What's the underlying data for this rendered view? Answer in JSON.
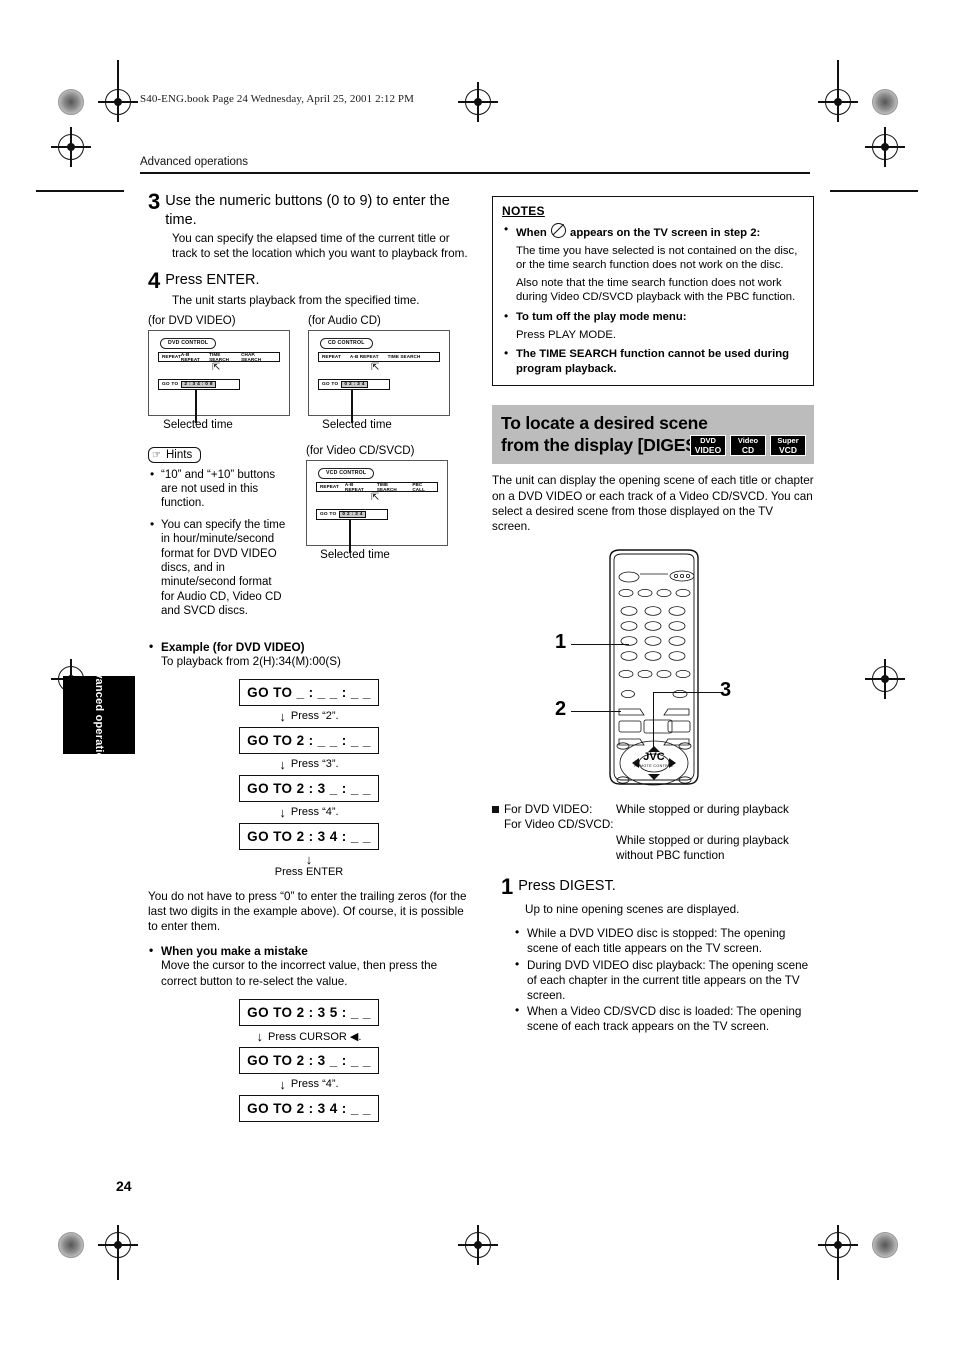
{
  "page": {
    "file_header": "S40-ENG.book  Page 24  Wednesday, April 25, 2001  2:12 PM",
    "running_head": "Advanced operations",
    "side_tab": "Advanced operations",
    "page_number": "24"
  },
  "left": {
    "step3": {
      "num": "3",
      "title": "Use the numeric buttons (0 to 9) to enter the time.",
      "body": "You can specify the elapsed time of the current title or track to set the location which you want to playback from."
    },
    "step4": {
      "num": "4",
      "title": "Press ENTER.",
      "body": "The unit starts playback from the specified time."
    },
    "figures": {
      "dvd": {
        "caption": "(for DVD VIDEO)",
        "pill": "DVD CONTROL",
        "menu": [
          "REPEAT",
          "A-B REPEAT",
          "TIME SEARCH",
          "CHAP. SEARCH"
        ],
        "goto_label": "GO TO",
        "goto_value": "2 : 3 4 : 0 8",
        "selected_caption": "Selected time"
      },
      "cd": {
        "caption": "(for Audio CD)",
        "pill": "CD CONTROL",
        "menu": [
          "REPEAT",
          "A-B REPEAT",
          "TIME SEARCH"
        ],
        "goto_label": "GO TO",
        "goto_value": "0 2 : 3 4",
        "selected_caption": "Selected time"
      },
      "vcd": {
        "caption": "(for Video CD/SVCD)",
        "pill": "VCD CONTROL",
        "menu": [
          "REPEAT",
          "A-B REPEAT",
          "TIME SEARCH",
          "PBC CALL"
        ],
        "goto_label": "GO TO",
        "goto_value": "0 2 : 3 4",
        "selected_caption": "Selected time"
      }
    },
    "hints": {
      "label": "Hints",
      "items": [
        "“10” and “+10” buttons are not used in this function.",
        "You can specify the time in hour/minute/second format for DVD VIDEO discs, and in minute/second format for Audio CD, Video CD and SVCD discs."
      ]
    },
    "example": {
      "heading": "Example (for DVD VIDEO)",
      "subtitle": "To playback from 2(H):34(M):00(S)",
      "steps": [
        {
          "display": "GO TO  _ : _ _ : _ _",
          "action": "Press “2”."
        },
        {
          "display": "GO TO  2 : _ _ : _ _",
          "action": "Press “3”."
        },
        {
          "display": "GO TO  2 : 3 _ : _ _",
          "action": "Press “4”."
        },
        {
          "display": "GO TO  2 : 3 4 : _ _",
          "action": "Press ENTER"
        }
      ]
    },
    "trailing_note": "You do not have to press “0” to enter the trailing zeros (for the last two digits in the example above). Of course, it is possible to enter them.",
    "mistake": {
      "heading": "When you make a mistake",
      "body": "Move the cursor to the incorrect value, then press the correct button to re-select the value.",
      "steps": [
        {
          "display": "GO TO  2 : 3 5 : _ _",
          "action": "Press CURSOR ◀."
        },
        {
          "display": "GO TO  2 : 3 _ : _ _",
          "action": "Press “4”."
        },
        {
          "display": "GO TO  2 : 3 4 : _ _",
          "action": ""
        }
      ]
    }
  },
  "right": {
    "notes": {
      "header": "NOTES",
      "items": [
        {
          "bold_before": "When",
          "has_prohibit_icon": true,
          "bold_after": "appears on the TV screen in step 2:",
          "paragraphs": [
            "The time you have selected is not contained on the disc, or the time search function does not work on the disc.",
            "Also note that the time search function does not work during Video CD/SVCD playback with the PBC function."
          ]
        },
        {
          "bold": "To tum off the play mode menu:",
          "paragraphs": [
            "Press PLAY MODE."
          ]
        },
        {
          "bold": "The TIME SEARCH function cannot be used during program playback.",
          "paragraphs": []
        }
      ]
    },
    "digest": {
      "title": "To locate a desired scene from the display [DIGEST]",
      "badges": [
        {
          "line1": "DVD",
          "line2": "VIDEO"
        },
        {
          "line1": "Video",
          "line2": "CD"
        },
        {
          "line1": "Super",
          "line2": "VCD"
        }
      ],
      "intro": "The unit can display the opening scene of each title or chapter on a DVD VIDEO or each track of a Video CD/SVCD.  You can select a desired scene from those displayed on the TV screen.",
      "remote": {
        "brand": "JVC",
        "brand_sub": "REMOTE CONTROL",
        "callouts": [
          "1",
          "2",
          "3"
        ]
      },
      "availability": {
        "label1": "For DVD VIDEO:",
        "value1": "While stopped or during playback",
        "label2": "For Video CD/SVCD:",
        "value2": "While stopped or during playback without PBC function"
      },
      "step1": {
        "num": "1",
        "title": "Press DIGEST.",
        "body": "Up to nine opening scenes are displayed.",
        "bullets": [
          "While a DVD VIDEO disc is stopped: The opening scene of each title appears on the TV screen.",
          "During DVD VIDEO disc playback: The opening scene of each chapter in the current title appears on the TV screen.",
          "When a Video CD/SVCD disc is loaded: The opening scene of each track appears on the TV screen."
        ]
      }
    }
  }
}
